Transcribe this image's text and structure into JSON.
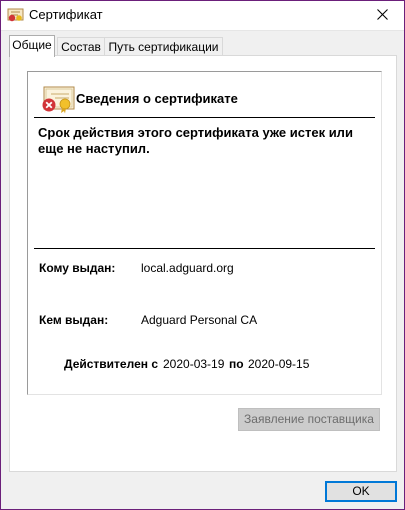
{
  "window": {
    "title": "Сертификат",
    "close_icon": "close-icon",
    "app_icon": "certificate-icon"
  },
  "tabs": [
    {
      "label": "Общие",
      "active": true
    },
    {
      "label": "Состав",
      "active": false
    },
    {
      "label": "Путь сертификации",
      "active": false
    }
  ],
  "certificate": {
    "icon": "certificate-error-icon",
    "heading": "Сведения о сертификате",
    "warning": "Срок действия этого сертификата уже истек или еще не наступил.",
    "issued_to_label": "Кому выдан:",
    "issued_to_value": "local.adguard.org",
    "issued_by_label": "Кем выдан:",
    "issued_by_value": "Adguard Personal CA",
    "valid_from_label": "Действителен с",
    "valid_from_value": "2020-03-19",
    "valid_to_label": "по",
    "valid_to_value": "2020-09-15"
  },
  "buttons": {
    "issuer_statement": "Заявление поставщика",
    "issuer_statement_enabled": false,
    "ok": "OK"
  },
  "colors": {
    "accent": "#0078d7",
    "window_border": "#6b1f7a"
  }
}
